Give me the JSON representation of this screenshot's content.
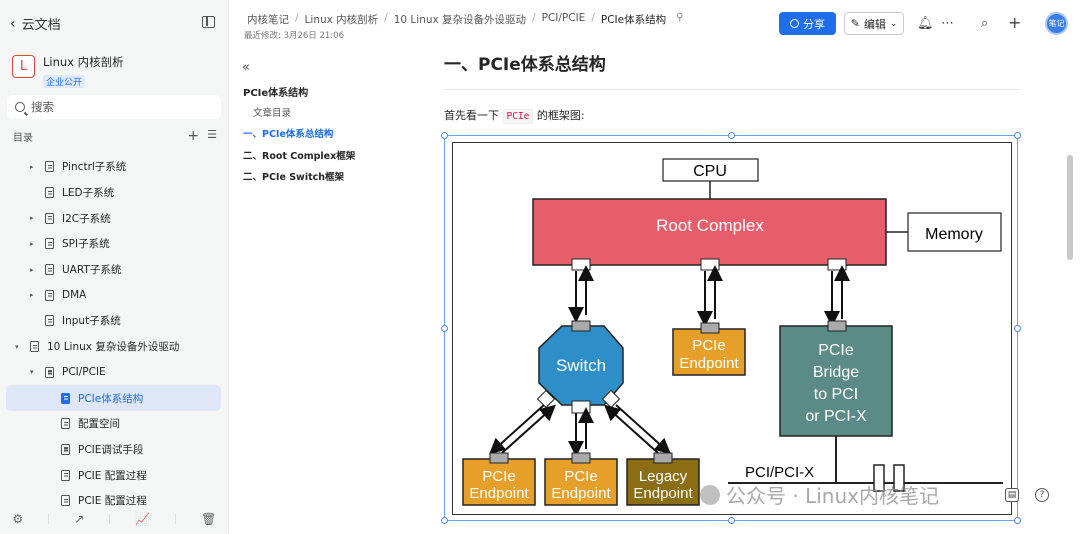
{
  "sidebar": {
    "back_label": "云文档",
    "book": {
      "logo": "L",
      "name": "Linux 内核剖析",
      "tag": "企业公开"
    },
    "search_placeholder": "搜索",
    "toc_label": "目录",
    "items": [
      {
        "label": "Pinctrl子系统",
        "depth": 1,
        "arrow": "▸"
      },
      {
        "label": "LED子系统",
        "depth": 1,
        "arrow": ""
      },
      {
        "label": "I2C子系统",
        "depth": 1,
        "arrow": "▸"
      },
      {
        "label": "SPI子系统",
        "depth": 1,
        "arrow": "▸"
      },
      {
        "label": "UART子系统",
        "depth": 1,
        "arrow": "▸"
      },
      {
        "label": "DMA",
        "depth": 1,
        "arrow": "▸"
      },
      {
        "label": "Input子系统",
        "depth": 1,
        "arrow": ""
      },
      {
        "label": "10 Linux 复杂设备外设驱动",
        "depth": 0,
        "arrow": "▾"
      },
      {
        "label": "PCI/PCIE",
        "depth": 1,
        "arrow": "▾"
      },
      {
        "label": "PCIe体系结构",
        "depth": 2,
        "arrow": "",
        "active": true
      },
      {
        "label": "配置空间",
        "depth": 2,
        "arrow": ""
      },
      {
        "label": "PCIE调试手段",
        "depth": 2,
        "arrow": ""
      },
      {
        "label": "PCIE 配置过程",
        "depth": 2,
        "arrow": ""
      },
      {
        "label": "PCIE 配置过程",
        "depth": 2,
        "arrow": ""
      }
    ]
  },
  "header": {
    "breadcrumbs": [
      "内核笔记",
      "Linux 内核剖析",
      "10 Linux 复杂设备外设驱动",
      "PCI/PCIE",
      "PCIe体系结构"
    ],
    "modified": "最近修改: 3月26日 21:06",
    "share_label": "分享",
    "edit_label": "编辑",
    "avatar_text": "笔记"
  },
  "outline": {
    "title": "PCIe体系结构",
    "items": [
      {
        "label": "文章目录",
        "type": "sub"
      },
      {
        "label": "一、PCIe体系总结构",
        "type": "active"
      },
      {
        "label": "二、Root Complex框架",
        "type": ""
      },
      {
        "label": "二、PCIe Switch框架",
        "type": ""
      }
    ]
  },
  "content": {
    "heading": "一、PCIe体系总结构",
    "para_before": "首先看一下",
    "para_code": "PCIe",
    "para_after": "的框架图:"
  },
  "diagram": {
    "cpu": "CPU",
    "root_complex": "Root Complex",
    "memory": "Memory",
    "switch": "Switch",
    "endpoint_line1": "PCIe",
    "endpoint_line2": "Endpoint",
    "bridge_lines": [
      "PCIe",
      "Bridge",
      "to PCI",
      "or PCI-X"
    ],
    "legacy_line1": "Legacy",
    "pci_bus": "PCI/PCI-X",
    "colors": {
      "root": "#e65d6b",
      "switch": "#2e8fc8",
      "endpoint": "#e6a02a",
      "legacy": "#8b6d14",
      "bridge": "#5b8b86"
    }
  },
  "watermark": "公众号 · Linux内核笔记"
}
